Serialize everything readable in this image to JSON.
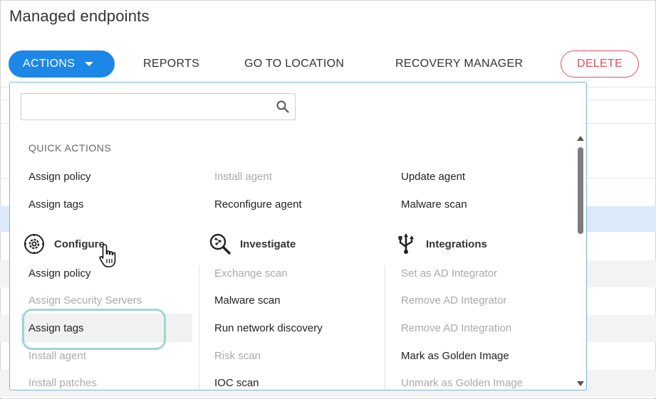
{
  "page": {
    "title": "Managed endpoints"
  },
  "toolbar": {
    "actions_label": "ACTIONS",
    "reports_label": "REPORTS",
    "go_to_location_label": "GO TO LOCATION",
    "recovery_manager_label": "RECOVERY MANAGER",
    "delete_label": "DELETE"
  },
  "colors": {
    "accent": "#1c87e6",
    "danger": "#e0505b",
    "highlight": "#9fd5d3",
    "selected_row": "#dbe9fb"
  },
  "dropdown": {
    "search": {
      "value": "",
      "placeholder": ""
    },
    "quick_actions": {
      "title": "QUICK ACTIONS",
      "col1": [
        {
          "label": "Assign policy",
          "enabled": true
        },
        {
          "label": "Assign tags",
          "enabled": true
        }
      ],
      "col2": [
        {
          "label": "Install agent",
          "enabled": false
        },
        {
          "label": "Reconfigure agent",
          "enabled": true
        }
      ],
      "col3": [
        {
          "label": "Update agent",
          "enabled": true
        },
        {
          "label": "Malware scan",
          "enabled": true
        }
      ]
    },
    "configure": {
      "title": "Configure",
      "icon": "gear-icon",
      "items": [
        {
          "label": "Assign policy",
          "enabled": true
        },
        {
          "label": "Assign Security Servers",
          "enabled": false
        },
        {
          "label": "Assign tags",
          "enabled": true
        },
        {
          "label": "Install agent",
          "enabled": false
        },
        {
          "label": "Install patches",
          "enabled": false
        }
      ]
    },
    "investigate": {
      "title": "Investigate",
      "icon": "magnifier-icon",
      "items": [
        {
          "label": "Exchange scan",
          "enabled": false
        },
        {
          "label": "Malware scan",
          "enabled": true
        },
        {
          "label": "Run network discovery",
          "enabled": true
        },
        {
          "label": "Risk scan",
          "enabled": false
        },
        {
          "label": "IOC scan",
          "enabled": true
        }
      ]
    },
    "integrations": {
      "title": "Integrations",
      "icon": "integration-icon",
      "items": [
        {
          "label": "Set as AD Integrator",
          "enabled": false
        },
        {
          "label": "Remove AD Integrator",
          "enabled": false
        },
        {
          "label": "Remove AD Integration",
          "enabled": false
        },
        {
          "label": "Mark as Golden Image",
          "enabled": true
        },
        {
          "label": "Unmark as Golden Image",
          "enabled": false
        }
      ]
    }
  }
}
